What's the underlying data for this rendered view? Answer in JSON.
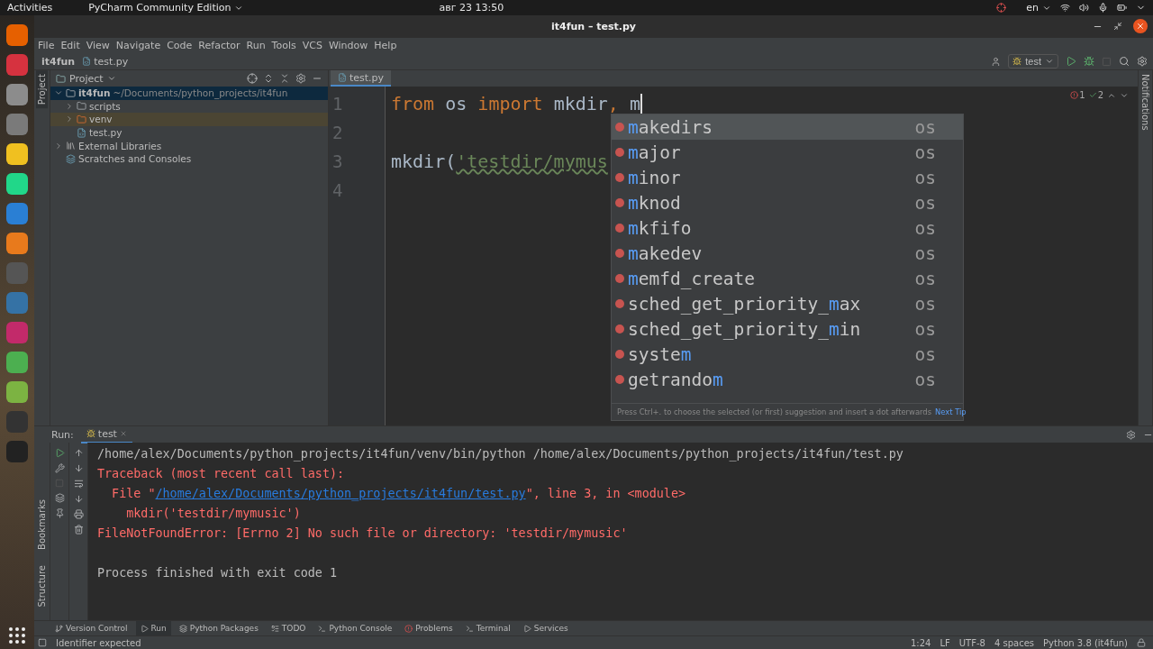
{
  "top_bar": {
    "activities": "Activities",
    "app_menu": "PyCharm Community Edition",
    "clock": "авг 23  13:50",
    "keyboard_layout": "en"
  },
  "window": {
    "title": "it4fun – test.py"
  },
  "menu": [
    "File",
    "Edit",
    "View",
    "Navigate",
    "Code",
    "Refactor",
    "Run",
    "Tools",
    "VCS",
    "Window",
    "Help"
  ],
  "breadcrumbs": [
    "it4fun",
    "test.py"
  ],
  "run_config": "test",
  "side_tabs": {
    "left_top": "Project",
    "left_bottom": [
      "Bookmarks",
      "Structure"
    ],
    "right": "Notifications"
  },
  "project_panel": {
    "title": "Project",
    "tree": [
      {
        "label": "it4fun",
        "path": "~/Documents/python_projects/it4fun",
        "kind": "root",
        "expanded": true,
        "selected": true,
        "children": [
          {
            "label": "scripts",
            "kind": "folder",
            "expanded": false,
            "selected": false
          },
          {
            "label": "venv",
            "kind": "excluded",
            "expanded": false,
            "selected": false
          },
          {
            "label": "test.py",
            "kind": "python",
            "selected": false
          }
        ]
      },
      {
        "label": "External Libraries",
        "kind": "library",
        "expanded": false,
        "selected": false
      },
      {
        "label": "Scratches and Consoles",
        "kind": "scratches",
        "selected": false
      }
    ]
  },
  "editor": {
    "tab": "test.py",
    "error_count": "1",
    "warning_count": "2",
    "lines": [
      {
        "number": "1",
        "cursor": true,
        "tokens": [
          {
            "kind": "keyword",
            "text": "from"
          },
          {
            "kind": "plain",
            "text": " os "
          },
          {
            "kind": "keyword",
            "text": "import"
          },
          {
            "kind": "plain",
            "text": " mkdir"
          },
          {
            "kind": "keyword",
            "text": ","
          },
          {
            "kind": "plain",
            "text": " m"
          }
        ]
      },
      {
        "number": "2",
        "cursor": false
      },
      {
        "number": "3",
        "cursor": false,
        "tokens": [
          {
            "kind": "plain",
            "text": "mkdir("
          },
          {
            "kind": "string",
            "text": "'testdir/mymus"
          }
        ]
      },
      {
        "number": "4",
        "cursor": false
      }
    ]
  },
  "completion": {
    "items": [
      {
        "match": "m",
        "after": "akedirs",
        "module": "os",
        "selected": true
      },
      {
        "match": "m",
        "after": "ajor",
        "module": "os",
        "selected": false
      },
      {
        "match": "m",
        "after": "inor",
        "module": "os",
        "selected": false
      },
      {
        "match": "m",
        "after": "knod",
        "module": "os",
        "selected": false
      },
      {
        "match": "m",
        "after": "kfifo",
        "module": "os",
        "selected": false
      },
      {
        "match": "m",
        "after": "akedev",
        "module": "os",
        "selected": false
      },
      {
        "match": "m",
        "after": "emfd_create",
        "module": "os",
        "selected": false
      },
      {
        "before": "sched_get_priority_",
        "match": "m",
        "after": "ax",
        "module": "os",
        "selected": false
      },
      {
        "before": "sched_get_priority_",
        "match": "m",
        "after": "in",
        "module": "os",
        "selected": false
      },
      {
        "before": "syste",
        "match": "m",
        "module": "os",
        "selected": false
      },
      {
        "before": "getrando",
        "match": "m",
        "module": "os",
        "selected": false
      }
    ],
    "hint": "Press Ctrl+. to choose the selected (or first) suggestion and insert a dot afterwards",
    "next_tip": "Next Tip"
  },
  "run": {
    "label": "Run:",
    "tab": "test",
    "output": [
      {
        "segments": [
          {
            "kind": "plain",
            "text": "/home/alex/Documents/python_projects/it4fun/venv/bin/python /home/alex/Documents/python_projects/it4fun/test.py"
          }
        ]
      },
      {
        "segments": [
          {
            "kind": "error",
            "text": "Traceback (most recent call last):"
          }
        ]
      },
      {
        "segments": [
          {
            "kind": "error",
            "text": "  File \""
          },
          {
            "kind": "link",
            "text": "/home/alex/Documents/python_projects/it4fun/test.py"
          },
          {
            "kind": "error",
            "text": "\", line 3, in <module>"
          }
        ]
      },
      {
        "segments": [
          {
            "kind": "error",
            "text": "    mkdir('testdir/mymusic')"
          }
        ]
      },
      {
        "segments": [
          {
            "kind": "error",
            "text": "FileNotFoundError: [Errno 2] No such file or directory: 'testdir/mymusic'"
          }
        ]
      },
      {
        "kind": "blank"
      },
      {
        "segments": [
          {
            "kind": "plain",
            "text": "Process finished with exit code 1"
          }
        ]
      }
    ]
  },
  "tool_windows": [
    {
      "label": "Version Control",
      "selected": false
    },
    {
      "label": "Run",
      "selected": true
    },
    {
      "label": "Python Packages",
      "selected": false
    },
    {
      "label": "TODO",
      "selected": false
    },
    {
      "label": "Python Console",
      "selected": false
    },
    {
      "label": "Problems",
      "selected": false
    },
    {
      "label": "Terminal",
      "selected": false
    },
    {
      "label": "Services",
      "selected": false
    }
  ],
  "status": {
    "message": "Identifier expected",
    "items": [
      "1:24",
      "LF",
      "UTF-8",
      "4 spaces",
      "Python 3.8 (it4fun)"
    ]
  }
}
